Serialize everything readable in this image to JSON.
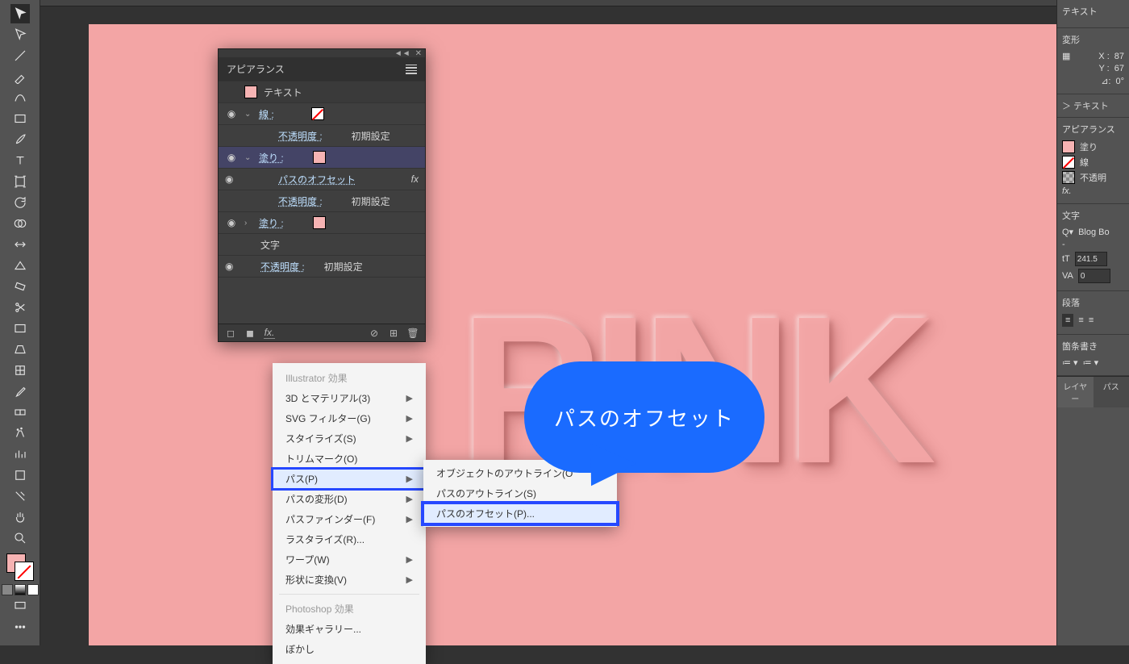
{
  "right": {
    "text_title": "テキスト",
    "transform_title": "変形",
    "x_label": "X :",
    "x_val": "87",
    "y_label": "Y :",
    "y_val": "67",
    "angle_label": "⊿:",
    "angle_val": "0°",
    "text_expand": "＞ テキスト",
    "appearance_title": "アピアランス",
    "fill_label": "塗り",
    "stroke_label": "線",
    "opacity_label": "不透明",
    "fx": "fx.",
    "char_title": "文字",
    "font": "Blog Bo",
    "style": "-",
    "size": "241.5",
    "kern": "0",
    "para_title": "段落",
    "line_title": "箇条書き",
    "layer_tab": "レイヤー",
    "path_tab": "パス"
  },
  "appear": {
    "title": "アピアランス",
    "text": "テキスト",
    "stroke": "線 :",
    "opacity": "不透明度 :",
    "default": "初期設定",
    "fill": "塗り :",
    "offset": "パスのオフセット",
    "chars": "文字",
    "fx": "fx"
  },
  "menu": {
    "hdr1": "Illustrator 効果",
    "items1": [
      {
        "label": "3D とマテリアル(3)",
        "sub": true
      },
      {
        "label": "SVG フィルター(G)",
        "sub": true
      },
      {
        "label": "スタイライズ(S)",
        "sub": true
      },
      {
        "label": "トリムマーク(O)"
      },
      {
        "label": "パス(P)",
        "sub": true,
        "hl": true
      },
      {
        "label": "パスの変形(D)",
        "sub": true
      },
      {
        "label": "パスファインダー(F)",
        "sub": true
      },
      {
        "label": "ラスタライズ(R)..."
      },
      {
        "label": "ワープ(W)",
        "sub": true
      },
      {
        "label": "形状に変換(V)",
        "sub": true
      }
    ],
    "hdr2": "Photoshop 効果",
    "items2": [
      {
        "label": "効果ギャラリー..."
      },
      {
        "label": "ぼかし"
      }
    ]
  },
  "submenu": {
    "items": [
      {
        "label": "オブジェクトのアウトライン(O"
      },
      {
        "label": "パスのアウトライン(S)"
      },
      {
        "label": "パスのオフセット(P)...",
        "hl": true
      }
    ]
  },
  "callout": "パスのオフセット",
  "canvas_text": "PINK"
}
